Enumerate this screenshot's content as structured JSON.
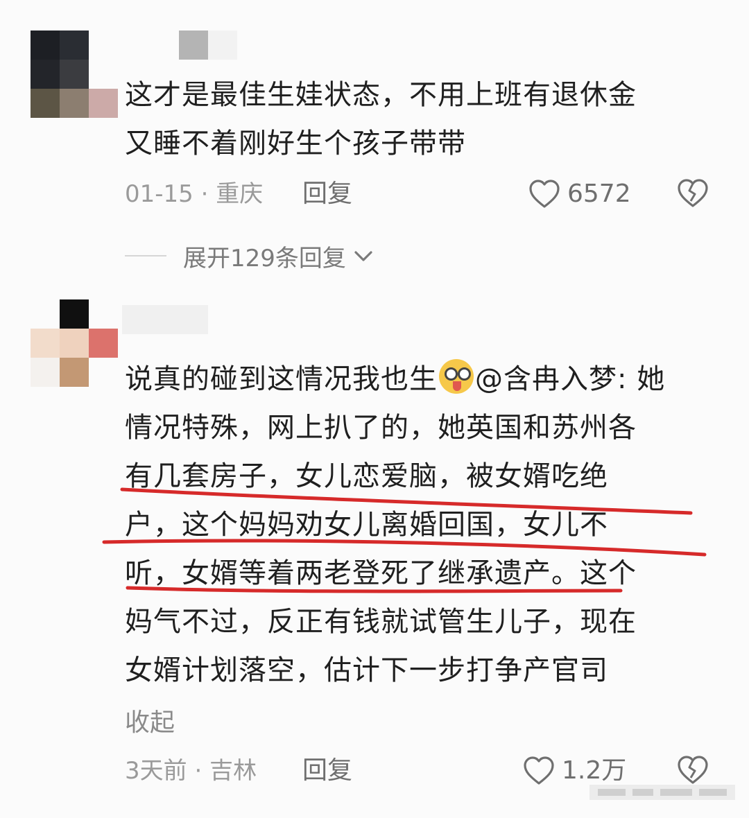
{
  "comments": [
    {
      "text_lines": [
        "这才是最佳生娃状态，不用上班有退休金",
        "又睡不着刚好生个孩子带带"
      ],
      "date": "01-15",
      "separator": "·",
      "location": "重庆",
      "reply_label": "回复",
      "likes": "6572",
      "expand_label": "展开129条回复"
    },
    {
      "text_lines": [
        "说真的碰到这情况我也生",
        "@含冉入梦: 她",
        "情况特殊，网上扒了的，她英国和苏州各",
        "有几套房子，女儿恋爱脑，被女婿吃绝",
        "户，这个妈妈劝女儿离婚回国，女儿不",
        "听，女婿等着两老登死了继承遗产。这个",
        "妈气不过，反正有钱就试管生儿子，现在",
        "女婿计划落空，估计下一步打争产官司"
      ],
      "collapse_label": "收起",
      "date": "3天前",
      "separator": "·",
      "location": "吉林",
      "reply_label": "回复",
      "likes": "1.2万"
    }
  ],
  "icons": {
    "like": "heart-outline-icon",
    "dislike": "broken-heart-icon",
    "expand": "chevron-down-icon",
    "emoji": "dizzy-tongue-emoji-icon"
  },
  "colors": {
    "annotation_underline": "#d62a2a",
    "meta_text": "#9a9a9a",
    "body_text": "#1f1f1f"
  }
}
